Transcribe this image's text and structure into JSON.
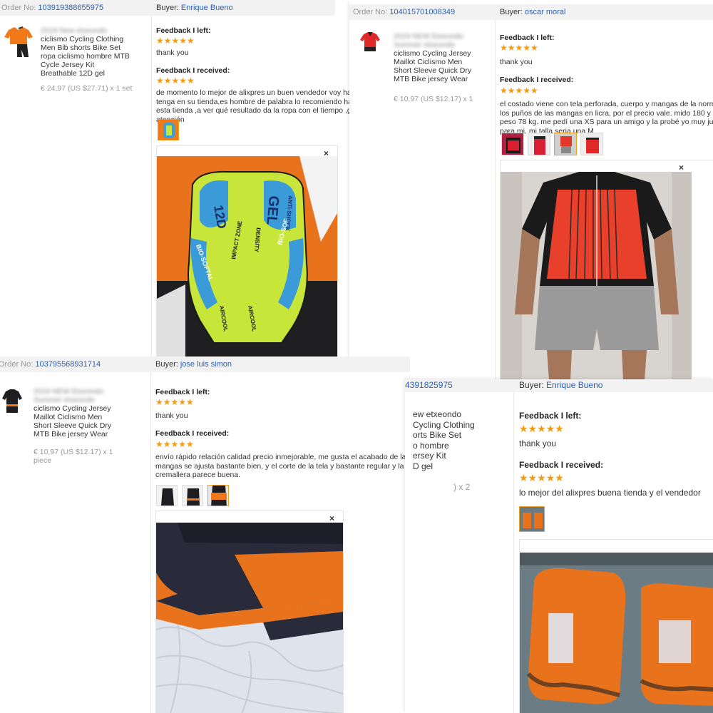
{
  "cards": [
    {
      "order_label": "Order No:",
      "order_no": "103919388655975",
      "buyer_label": "Buyer:",
      "buyer": "Enrique Bueno",
      "product_title_blurred": "2019 New etxeondo",
      "product_title": "ciclismo Cycling Clothing Men Bib shorts Bike Set ropa ciclismo hombre MTB Cycle Jersey Kit Breathable 12D gel",
      "price": "€ 24,97 (US $27.71) x 1 set",
      "feedback_left_label": "Feedback I left:",
      "feedback_left_stars": "★★★★★",
      "feedback_left_text": "thank you",
      "feedback_received_label": "Feedback I received:",
      "feedback_received_stars": "★★★★★",
      "feedback_received_text": "de momento lo mejor de alixpres un buen vendedor voy ha comprar todo lo que tenga en su tienda,es hombre de palabra lo recomiendo ha todos los que vean esta tienda ,a ver qué resultado da la ropa con el tiempo ,gracias por la atención",
      "close": "×",
      "pad_labels": {
        "pad1": "12D",
        "pad2": "GEL",
        "pad3": "ANTI-SHOCK",
        "pad4": "IMPACT ZONE",
        "pad5": "DENSITY",
        "pad6": "BIO-SOFTAL",
        "pad7": "AIRCOOL",
        "pad8": "AIRCOOL",
        "pad9": "BIO-SOF"
      }
    },
    {
      "order_label": "Order No:",
      "order_no": "104015701008349",
      "buyer_label": "Buyer:",
      "buyer": "oscar moral",
      "product_title_blurred": "2019 NEW Etxeondo Summer etxeondo",
      "product_title": "ciclismo Cycling Jersey Maillot Ciclismo Men Short Sleeve Quick Dry MTB Bike jersey Wear",
      "price": "€ 10,97 (US $12.17) x 1",
      "feedback_left_label": "Feedback I left:",
      "feedback_left_stars": "★★★★★",
      "feedback_left_text": "thank you",
      "feedback_received_label": "Feedback I received:",
      "feedback_received_stars": "★★★★★",
      "feedback_received_text": "el costado viene con tela perforada, cuerpo y mangas de la normal y los puños de las mangas en licra, por el precio vale. mido 180 y peso 78 kg. me pedí una XS para un amigo y la probé yo muy justa para mi. mi talla seria una M",
      "close": "×"
    },
    {
      "order_label": "Order No:",
      "order_no": "103795568931714",
      "buyer_label": "Buyer:",
      "buyer": "jose luis simon",
      "product_title_blurred": "2019 NEW Etxeondo Summer etxeondo",
      "product_title": "ciclismo Cycling Jersey Maillot Ciclismo Men Short Sleeve Quick Dry MTB Bike jersey Wear",
      "price": "€ 10,97 (US $12.17) x 1 piece",
      "feedback_left_label": "Feedback I left:",
      "feedback_left_stars": "★★★★★",
      "feedback_left_text": "thank you",
      "feedback_received_label": "Feedback I received:",
      "feedback_received_stars": "★★★★★",
      "feedback_received_text": "envío rápido relación calidad precio inmejorable, me gusta el acabado de las mangas se ajusta bastante bien, y el corte de la tela y bastante regular y la cremallera parece buena.",
      "close": "×"
    },
    {
      "order_no_partial": "4391825975",
      "buyer_label": "Buyer:",
      "buyer": "Enrique Bueno",
      "product_lines": [
        "ew etxeondo",
        "Cycling Clothing",
        "orts Bike Set",
        "o hombre",
        "ersey Kit",
        "D gel"
      ],
      "price_partial": ") x 2",
      "feedback_left_label": "Feedback I left:",
      "feedback_left_stars": "★★★★★",
      "feedback_left_text": "thank you",
      "feedback_received_label": "Feedback I received:",
      "feedback_received_stars": "★★★★★",
      "feedback_received_text": "lo mejor del alixpres buena tienda y el vendedor"
    }
  ],
  "colors": {
    "link": "#2d5fb3",
    "star": "#f39c12",
    "header_bg": "#f2f2f2",
    "accent_orange": "#f07a1a"
  }
}
